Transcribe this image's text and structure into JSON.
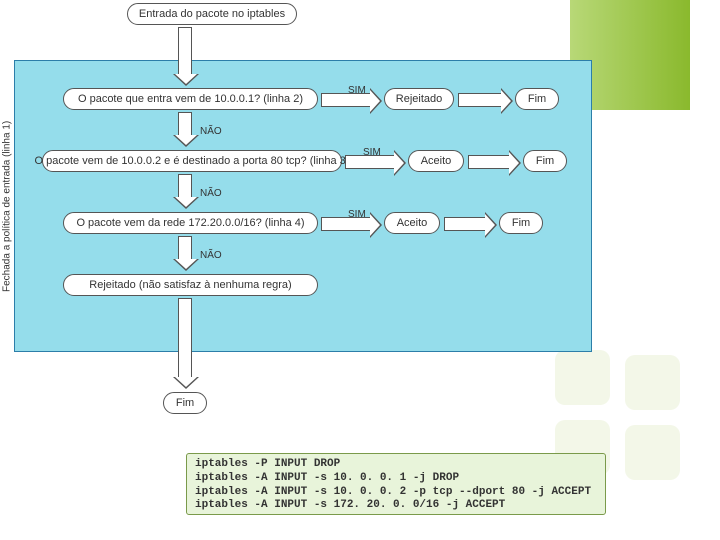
{
  "chart_data": {
    "type": "flowchart",
    "title": "Fechada a política de entrada (linha 1)",
    "start": "Entrada do pacote no iptables",
    "steps": [
      {
        "question": "O pacote que entra vem de 10.0.0.1? (linha 2)",
        "yes": "SIM",
        "yes_result": "Rejeitado",
        "yes_end": "Fim",
        "no": "NÃO"
      },
      {
        "question": "O pacote vem de 10.0.0.2 e é destinado a porta 80 tcp? (linha 3)",
        "yes": "SIM",
        "yes_result": "Aceito",
        "yes_end": "Fim",
        "no": "NÃO"
      },
      {
        "question": "O pacote vem da rede 172.20.0.0/16? (linha 4)",
        "yes": "SIM",
        "yes_result": "Aceito",
        "yes_end": "Fim",
        "no": "NÃO"
      }
    ],
    "default_result": "Rejeitado (não satisfaz à nenhuma regra)",
    "end": "Fim"
  },
  "sidebar_label": "Fechada a política de entrada (linha 1)",
  "node": {
    "start": "Entrada do pacote no iptables",
    "q1": "O pacote que entra vem de 10.0.0.1? (linha 2)",
    "q2": "O pacote vem de 10.0.0.2 e é destinado a porta 80 tcp? (linha 3)",
    "q3": "O pacote vem da rede 172.20.0.0/16? (linha 4)",
    "default": "Rejeitado (não satisfaz à nenhuma regra)",
    "rej": "Rejeitado",
    "ac": "Aceito",
    "fim": "Fim"
  },
  "label": {
    "sim": "SIM",
    "nao": "NÃO"
  },
  "code": "iptables -P INPUT DROP\niptables -A INPUT -s 10. 0. 0. 1 -j DROP\niptables -A INPUT -s 10. 0. 0. 2 -p tcp --dport 80 -j ACCEPT\niptables -A INPUT -s 172. 20. 0. 0/16 -j ACCEPT"
}
